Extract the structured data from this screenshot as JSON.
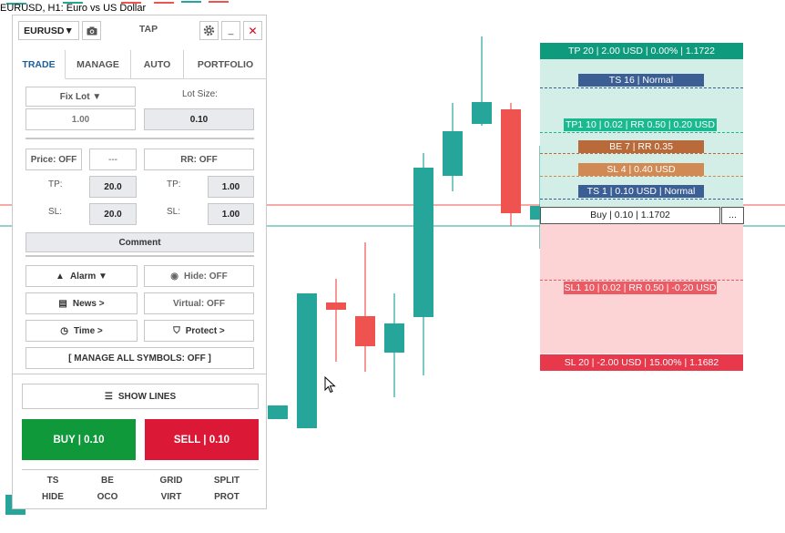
{
  "chart_window": {
    "title": "EURUSD, H1:  Euro vs US Dollar"
  },
  "colors": {
    "bull": "#26a69a",
    "bear": "#ef5350",
    "tp_zone": "#d3eee6",
    "sl_zone": "#fcd4d6",
    "tp_label": "#0e9a7d",
    "sl_label": "#e8384b",
    "ts_label": "#3b5f94",
    "be_label": "#b86a3a",
    "sl_partial": "#d28a55",
    "tp1_label": "#1ab990",
    "sl1_label": "#ec5b63"
  },
  "chart_data": {
    "type": "candlestick",
    "candles": [
      {
        "o": 4,
        "h": 5,
        "l": 2,
        "c": 3
      },
      {
        "o": 3,
        "h": 4,
        "l": 2,
        "c": 2
      },
      {
        "o": 2,
        "h": 3,
        "l": 1,
        "c": 2
      },
      {
        "o": 2,
        "h": 3,
        "l": 1,
        "c": 2
      },
      {
        "o": 2,
        "h": 3,
        "l": 1,
        "c": 1
      },
      {
        "o": 1,
        "h": 2,
        "l": 0,
        "c": 1
      },
      {
        "o": 460,
        "h": 460,
        "l": 396,
        "c": 445
      },
      {
        "o": 470,
        "h": 480,
        "l": 315,
        "c": 322
      },
      {
        "o": 332,
        "h": 306,
        "l": 397,
        "c": 340
      },
      {
        "o": 347,
        "h": 266,
        "l": 408,
        "c": 380
      },
      {
        "o": 387,
        "h": 322,
        "l": 436,
        "c": 355
      },
      {
        "o": 348,
        "h": 168,
        "l": 412,
        "c": 184
      },
      {
        "o": 193,
        "h": 113,
        "l": 210,
        "c": 144
      },
      {
        "o": 136,
        "h": 40,
        "l": 138,
        "c": 112
      },
      {
        "o": 120,
        "h": 113,
        "l": 248,
        "c": 234
      },
      {
        "o": 241,
        "h": 160,
        "l": 273,
        "c": 226
      }
    ]
  },
  "trade_overlay": {
    "tp_main": "TP 20 | 2.00 USD | 0.00% | 1.1722",
    "ts16": "TS 16 | Normal",
    "tp1": "TP1 10 | 0.02 | RR 0.50 | 0.20 USD",
    "be7": "BE 7 | RR 0.35",
    "sl4": "SL 4 | 0.40 USD",
    "ts1": "TS 1 | 0.10 USD | Normal",
    "entry": "Buy | 0.10 | 1.1702",
    "entry_more": "...",
    "sl1": "SL1 10 | 0.02 | RR 0.50 | -0.20 USD",
    "sl_main": "SL 20 | -2.00 USD | 15.00% | 1.1682"
  },
  "panel": {
    "symbol": "EURUSD▼",
    "app_name": "TAP",
    "minimize": "_",
    "close": "✕",
    "tabs": [
      "TRADE",
      "MANAGE",
      "AUTO",
      "PORTFOLIO"
    ],
    "lot_mode": "Fix Lot ▼",
    "lot_size_label": "Lot Size:",
    "lot_value": "1.00",
    "lot_size_value": "0.10",
    "price_toggle": "Price: OFF",
    "price_dash": "---",
    "rr_toggle": "RR: OFF",
    "tp_label_left": "TP:",
    "tp_value_left": "20.0",
    "tp_label_right": "TP:",
    "tp_value_right": "1.00",
    "sl_label_left": "SL:",
    "sl_value_left": "20.0",
    "sl_label_right": "SL:",
    "sl_value_right": "1.00",
    "comment": "Comment",
    "alarm": "Alarm ▼",
    "hide": "Hide: OFF",
    "news": "News >",
    "virtual": "Virtual: OFF",
    "time": "Time >",
    "protect": "Protect >",
    "manage_all": "[ MANAGE ALL SYMBOLS: OFF ]",
    "show_lines": "SHOW LINES",
    "buy": "BUY | 0.10",
    "sell": "SELL | 0.10",
    "bottom_row1": [
      "TS",
      "BE",
      "GRID",
      "SPLIT"
    ],
    "bottom_row2": [
      "HIDE",
      "OCO",
      "VIRT",
      "PROT"
    ]
  }
}
